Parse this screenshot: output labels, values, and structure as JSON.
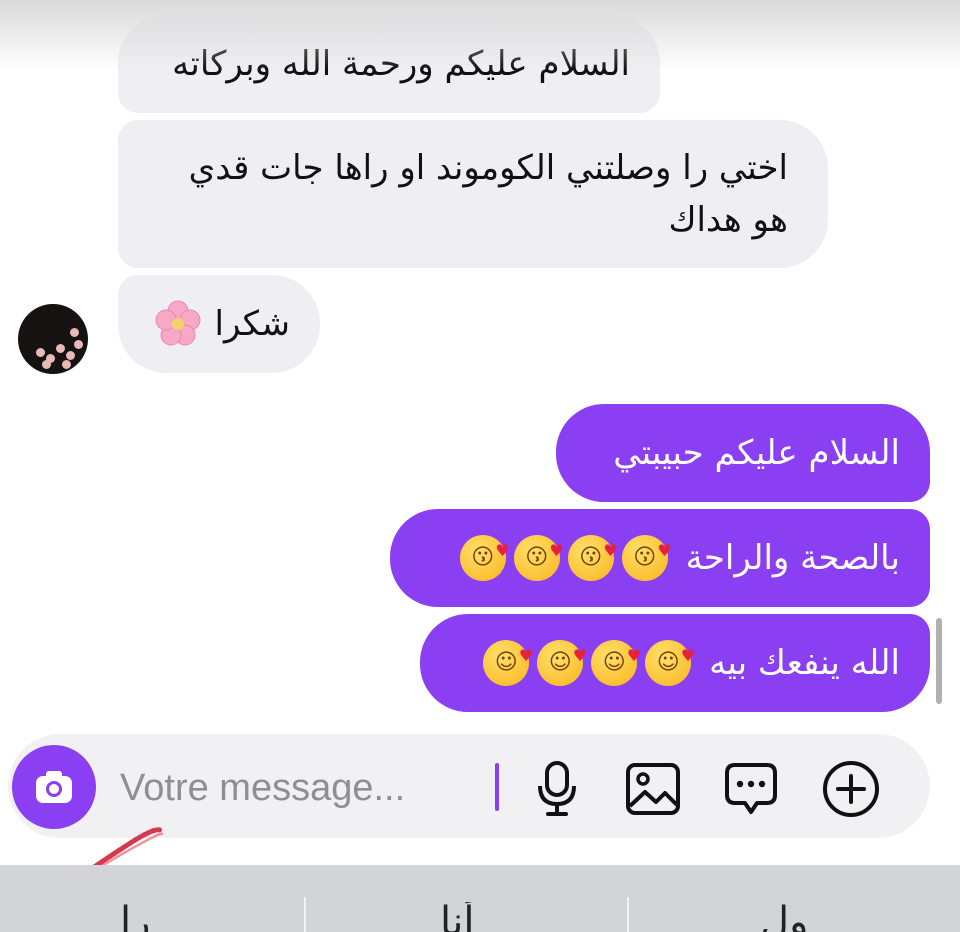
{
  "conversation": {
    "received": [
      {
        "text": "السلام عليكم ورحمة الله وبركاته"
      },
      {
        "text": "اختي را وصلتني الكوموند او راها جات قدي هو هداك"
      },
      {
        "text": "شكرا",
        "emoji": "cherry-blossom"
      }
    ],
    "sent": [
      {
        "text": "السلام عليكم حبيبتي"
      },
      {
        "text": "بالصحة والراحة",
        "emoji": "kissing-heart",
        "emoji_count": 4
      },
      {
        "text": "الله ينفعك بيه",
        "emoji": "smiling-face-with-hearts",
        "emoji_count": 4
      }
    ]
  },
  "composer": {
    "placeholder": "Votre message..."
  },
  "icons": {
    "camera": "camera-icon",
    "microphone": "microphone-icon",
    "image": "image-icon",
    "chat": "chat-bubble-icon",
    "add": "plus-circle-icon"
  },
  "keyboard": {
    "suggestions": [
      "را",
      "أنا",
      "ول"
    ]
  },
  "colors": {
    "accent": "#8a3ff3",
    "received_bubble": "#efeff3",
    "composer_bg": "#f1f1f4",
    "keyboard_bg": "#d3d4d8"
  }
}
